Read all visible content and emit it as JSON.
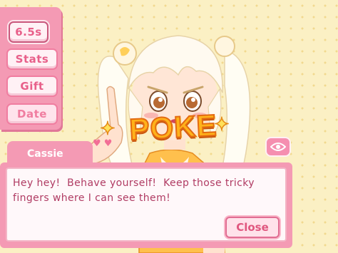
{
  "menu": {
    "timer_label": "6.5s",
    "stats_label": "Stats",
    "gift_label": "Gift",
    "date_label": "Date"
  },
  "effect": {
    "text": "POKE"
  },
  "dialog": {
    "speaker": "Cassie",
    "message": "Hey hey!  Behave yourself!  Keep those tricky fingers where I can see them!",
    "close_label": "Close"
  },
  "icons": {
    "eye": "eye-icon",
    "hearts": "hearts-icon",
    "stars": "star-icon"
  },
  "colors": {
    "background": "#fbf0c4",
    "panel_pink": "#f49ab4",
    "text_pink": "#b03b63",
    "poke_orange": "#ffb21a"
  }
}
